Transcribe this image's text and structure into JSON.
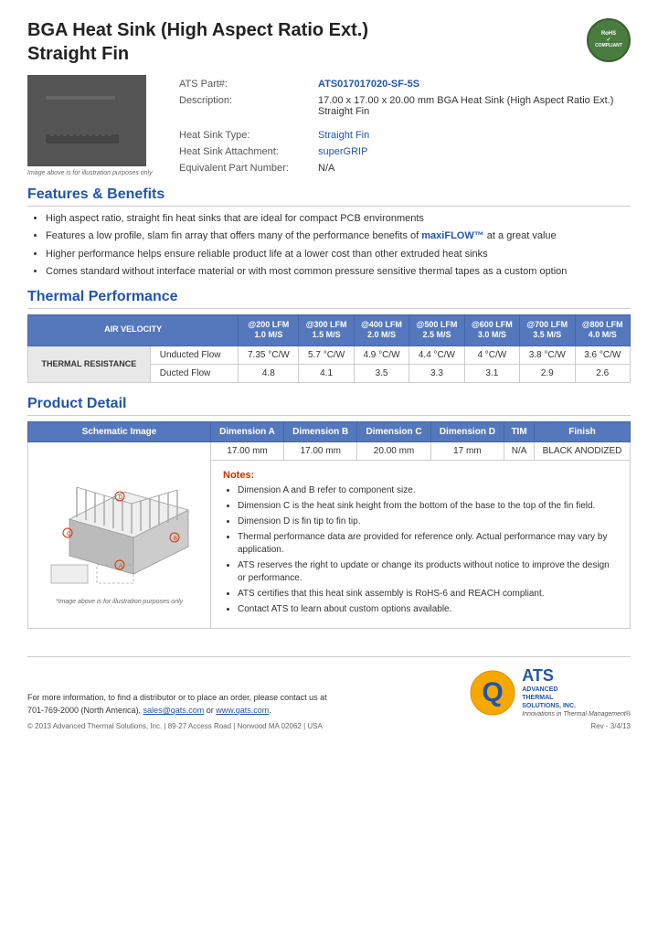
{
  "header": {
    "title_line1": "BGA Heat Sink (High Aspect Ratio Ext.)",
    "title_line2": "Straight Fin",
    "rohs_label": "RoHS COMPLIANT"
  },
  "product_specs": {
    "part_number_label": "ATS Part#:",
    "part_number_value": "ATS017017020-SF-5S",
    "description_label": "Description:",
    "description_value": "17.00 x 17.00 x 20.00 mm BGA Heat Sink (High Aspect Ratio Ext.) Straight Fin",
    "heat_sink_type_label": "Heat Sink Type:",
    "heat_sink_type_value": "Straight Fin",
    "heat_sink_attachment_label": "Heat Sink Attachment:",
    "heat_sink_attachment_value": "superGRIP",
    "equivalent_part_label": "Equivalent Part Number:",
    "equivalent_part_value": "N/A"
  },
  "image_caption": "Image above is for illustration purposes only",
  "features": {
    "section_title": "Features & Benefits",
    "items": [
      "High aspect ratio, straight fin heat sinks that are ideal for compact PCB environments",
      "Features a low profile, slam fin array that offers many of the performance benefits of maxiFLOW™ at a great value",
      "Higher performance helps ensure reliable product life at a lower cost than other extruded heat sinks",
      "Comes standard without interface material or with most common pressure sensitive thermal tapes as a custom option"
    ]
  },
  "thermal_performance": {
    "section_title": "Thermal Performance",
    "headers": {
      "air_velocity": "AIR VELOCITY",
      "col1": "@200 LFM\n1.0 M/S",
      "col2": "@300 LFM\n1.5 M/S",
      "col3": "@400 LFM\n2.0 M/S",
      "col4": "@500 LFM\n2.5 M/S",
      "col5": "@600 LFM\n3.0 M/S",
      "col6": "@700 LFM\n3.5 M/S",
      "col7": "@800 LFM\n4.0 M/S"
    },
    "row_label": "THERMAL RESISTANCE",
    "unducted_label": "Unducted Flow",
    "unducted_values": [
      "7.35 °C/W",
      "5.7 °C/W",
      "4.9 °C/W",
      "4.4 °C/W",
      "4 °C/W",
      "3.8 °C/W",
      "3.6 °C/W"
    ],
    "ducted_label": "Ducted Flow",
    "ducted_values": [
      "4.8",
      "4.1",
      "3.5",
      "3.3",
      "3.1",
      "2.9",
      "2.6"
    ]
  },
  "product_detail": {
    "section_title": "Product Detail",
    "table_headers": [
      "Schematic Image",
      "Dimension A",
      "Dimension B",
      "Dimension C",
      "Dimension D",
      "TIM",
      "Finish"
    ],
    "dim_values": [
      "17.00 mm",
      "17.00 mm",
      "20.00 mm",
      "17 mm",
      "N/A",
      "BLACK ANODIZED"
    ],
    "schematic_caption": "*Image above is for illustration purposes only",
    "notes_title": "Notes:",
    "notes": [
      "Dimension A and B refer to component size.",
      "Dimension C is the heat sink height from the bottom of the base to the top of the fin field.",
      "Dimension D is fin tip to fin tip.",
      "Thermal performance data are provided for reference only. Actual performance may vary by application.",
      "ATS reserves the right to update or change its products without notice to improve the design or performance.",
      "ATS certifies that this heat sink assembly is RoHS-6 and REACH compliant.",
      "Contact ATS to learn about custom options available."
    ]
  },
  "footer": {
    "contact_text": "For more information, to find a distributor or to place an order, please contact us at\n701-769-2000 (North America),",
    "email": "sales@qats.com",
    "or_text": "or",
    "website": "www.qats.com",
    "copyright": "© 2013 Advanced Thermal Solutions, Inc. | 89-27 Access Road | Norwood MA  02062 | USA",
    "page_num": "Rev - 3/4/13",
    "ats_tagline": "Innovations in Thermal Management®",
    "ats_name": "ADVANCED\nTHERMAL\nSOLUTIONS, INC."
  }
}
